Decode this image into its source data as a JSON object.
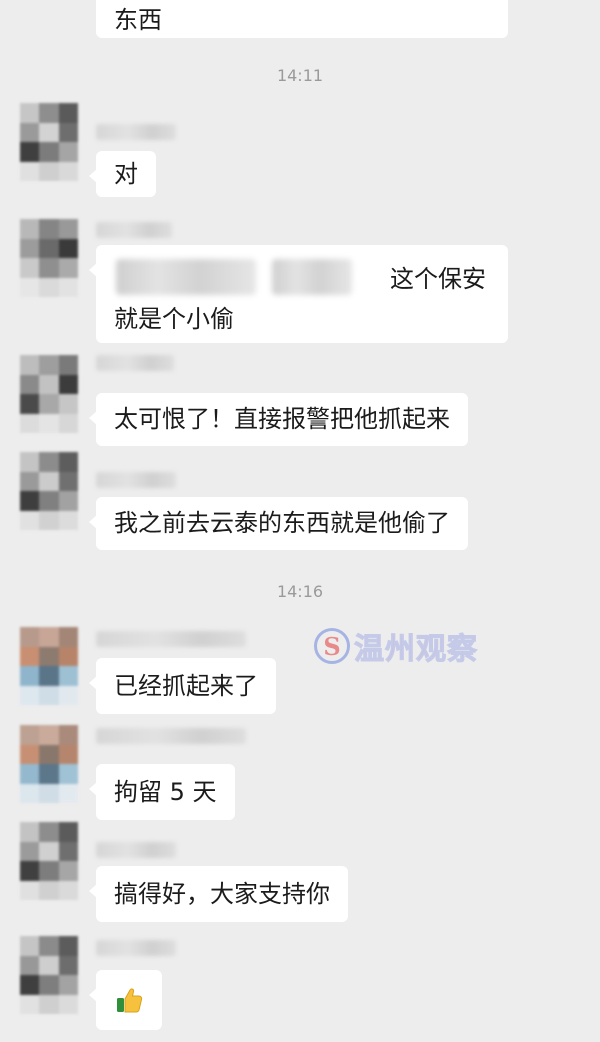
{
  "timestamps": [
    "14:11",
    "14:16"
  ],
  "messages": [
    {
      "text": "东西"
    },
    {
      "text": "对"
    },
    {
      "line1": "这个保安",
      "line2": "就是个小偷"
    },
    {
      "text": "太可恨了！直接报警把他抓起来"
    },
    {
      "text": "我之前去云泰的东西就是他偷了"
    },
    {
      "text": "已经抓起来了"
    },
    {
      "text": "拘留 5 天"
    },
    {
      "text": "搞得好，大家支持你"
    },
    {
      "emoji": "thumbs-up-icon"
    }
  ],
  "watermark": {
    "logo_letter": "S",
    "text": "温州观察"
  },
  "colors": {
    "background": "#ededed",
    "bubble": "#ffffff",
    "timestamp": "#9a9a9a"
  }
}
